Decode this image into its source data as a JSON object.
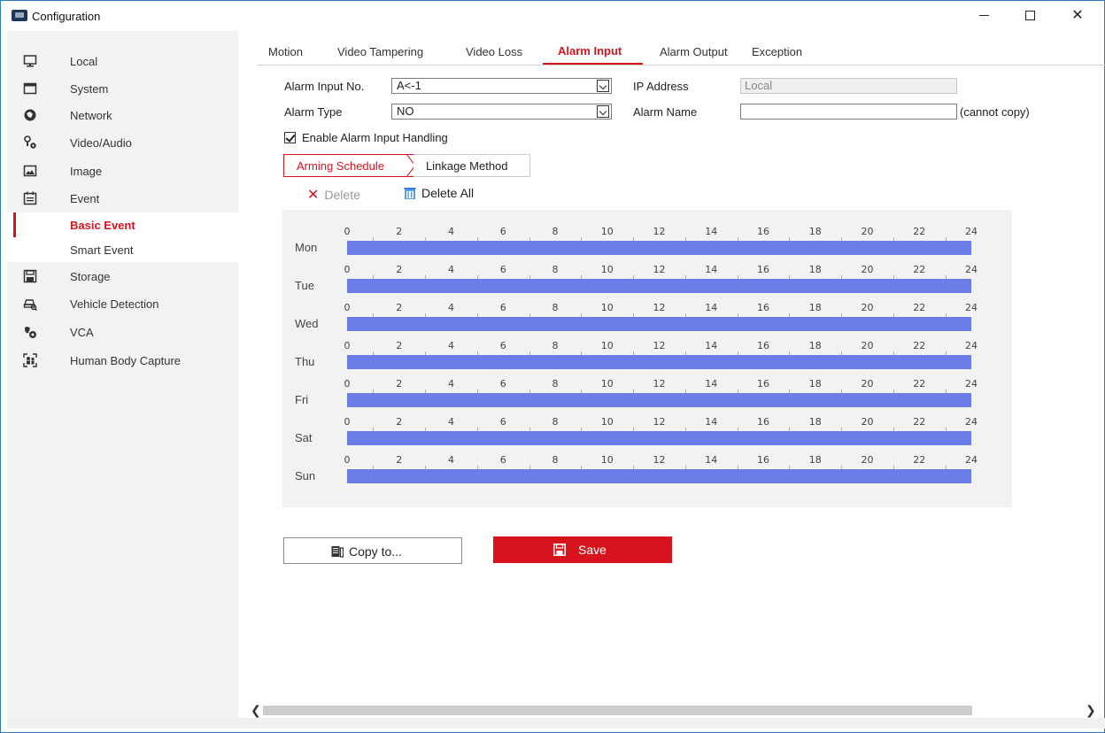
{
  "window": {
    "title": "Configuration",
    "controls": {
      "minimize": "—",
      "maximize": "☐",
      "close": "✕"
    }
  },
  "sidebar": {
    "items": [
      {
        "label": "Local",
        "icon": "monitor-icon"
      },
      {
        "label": "System",
        "icon": "system-icon"
      },
      {
        "label": "Network",
        "icon": "network-icon"
      },
      {
        "label": "Video/Audio",
        "icon": "video-audio-icon"
      },
      {
        "label": "Image",
        "icon": "image-icon"
      },
      {
        "label": "Event",
        "icon": "calendar-icon"
      },
      {
        "label": "Basic Event",
        "icon": "",
        "active": true
      },
      {
        "label": "Smart Event",
        "icon": ""
      },
      {
        "label": "Storage",
        "icon": "storage-icon"
      },
      {
        "label": "Vehicle Detection",
        "icon": "vehicle-icon"
      },
      {
        "label": "VCA",
        "icon": "vca-icon"
      },
      {
        "label": "Human Body Capture",
        "icon": "human-body-icon"
      }
    ]
  },
  "tabs": [
    "Motion",
    "Video Tampering",
    "Video Loss",
    "Alarm Input",
    "Alarm Output",
    "Exception"
  ],
  "active_tab": "Alarm Input",
  "form": {
    "alarm_input_no_label": "Alarm Input No.",
    "alarm_input_no_value": "A<-1",
    "ip_address_label": "IP Address",
    "ip_address_value": "Local",
    "alarm_type_label": "Alarm Type",
    "alarm_type_value": "NO",
    "alarm_name_label": "Alarm Name",
    "alarm_name_value": "",
    "cannot_copy": "(cannot copy)",
    "enable_label": "Enable Alarm Input Handling",
    "enable_checked": true
  },
  "subtabs": {
    "arming": "Arming Schedule",
    "linkage": "Linkage Method"
  },
  "actions": {
    "delete": "Delete",
    "delete_all": "Delete All"
  },
  "schedule": {
    "days": [
      "Mon",
      "Tue",
      "Wed",
      "Thu",
      "Fri",
      "Sat",
      "Sun"
    ],
    "hour_ticks": [
      "0",
      "2",
      "4",
      "6",
      "8",
      "10",
      "12",
      "14",
      "16",
      "18",
      "20",
      "22",
      "24"
    ],
    "bar_color": "#6b7de6",
    "armed_ranges": [
      [
        0,
        24
      ],
      [
        0,
        24
      ],
      [
        0,
        24
      ],
      [
        0,
        24
      ],
      [
        0,
        24
      ],
      [
        0,
        24
      ],
      [
        0,
        24
      ]
    ]
  },
  "buttons": {
    "copy": "Copy to...",
    "save": "Save"
  },
  "colors": {
    "accent": "#d7141d",
    "schedule_bar": "#6b7de6"
  }
}
